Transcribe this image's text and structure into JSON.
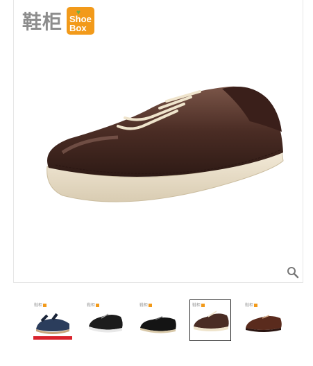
{
  "brand": {
    "name": "鞋柜",
    "logo_line1": "Shoe",
    "logo_line2": "Box",
    "accent": "#f29a1a"
  },
  "main_image": {
    "description_icon": "shoe-image"
  },
  "zoom": {
    "icon": "magnifier-icon"
  },
  "thumbnails": [
    {
      "label": "鞋柜",
      "icon": "sandal-icon",
      "active": false
    },
    {
      "label": "鞋柜",
      "icon": "black-sneaker-icon",
      "active": false
    },
    {
      "label": "鞋柜",
      "icon": "black-derby-icon",
      "active": false
    },
    {
      "label": "鞋柜",
      "icon": "brown-sneaker-icon",
      "active": true
    },
    {
      "label": "鞋柜",
      "icon": "brown-derby-icon",
      "active": false
    }
  ]
}
